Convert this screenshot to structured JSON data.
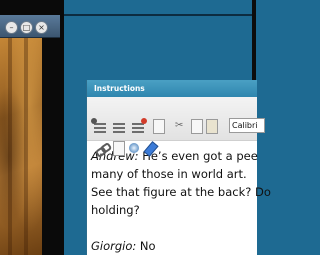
{
  "background_window": {
    "buttons": [
      {
        "name": "minimize",
        "glyph": "–"
      },
      {
        "name": "maximize",
        "glyph": "□"
      },
      {
        "name": "close",
        "glyph": "×"
      }
    ]
  },
  "panel": {
    "title": "Instructions",
    "toolbar": {
      "font_family": "Calibri",
      "icons": [
        "bullet-list-add-icon",
        "numbered-list-icon",
        "list-remove-icon",
        "print-icon",
        "cut-icon",
        "copy-icon",
        "paste-icon",
        "link-icon",
        "document-icon",
        "media-icon",
        "highlight-icon"
      ]
    },
    "dialogue": [
      {
        "speaker": "Andrew:",
        "text": " He’s even got a pee"
      },
      {
        "speaker": "",
        "text": "many of those in world art."
      },
      {
        "speaker": "",
        "text": "See that figure at the back? Do"
      },
      {
        "speaker": "",
        "text": "holding?"
      },
      {
        "speaker": "Giorgio:",
        "text": " No"
      }
    ]
  },
  "colors": {
    "desktop": "#1e6a92",
    "panel_title": "#3a93bb"
  }
}
